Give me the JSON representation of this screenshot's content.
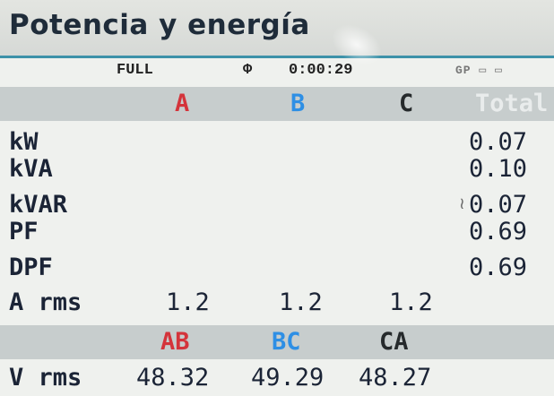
{
  "title": "Potencia y energía",
  "status": {
    "mode": "FULL",
    "clock_icon": "Φ",
    "elapsed": "0:00:29",
    "icons": "GP ▭ ▭"
  },
  "phase_header": {
    "a": "A",
    "b": "B",
    "c": "C",
    "total": "Total"
  },
  "rows": {
    "kw": {
      "label": "kW",
      "total": "0.07"
    },
    "kva": {
      "label": "kVA",
      "total": "0.10"
    },
    "kvar": {
      "label": "kVAR",
      "total": "0.07",
      "marker": "≀"
    },
    "pf": {
      "label": "PF",
      "total": "0.69"
    },
    "dpf": {
      "label": "DPF",
      "total": "0.69"
    },
    "arms": {
      "label": "A rms",
      "a": "1.2",
      "b": "1.2",
      "c": "1.2"
    }
  },
  "line_header": {
    "ab": "AB",
    "bc": "BC",
    "ca": "CA"
  },
  "vrms": {
    "label": "V rms",
    "ab": "48.32",
    "bc": "49.29",
    "ca": "48.27"
  },
  "colors": {
    "phase_a": "#d4343b",
    "phase_b": "#2e8fe5",
    "phase_c": "#262a2c",
    "accent_line": "#3d92a9",
    "band": "#c7cdcd"
  }
}
